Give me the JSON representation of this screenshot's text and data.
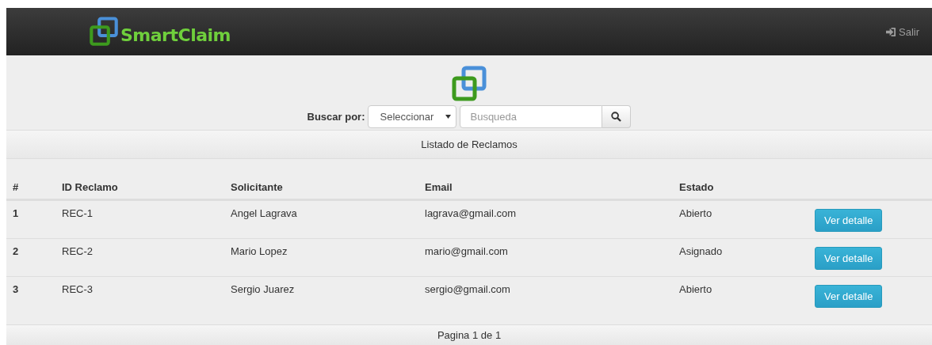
{
  "navbar": {
    "brand": "SmartClaim",
    "logout": "Salir"
  },
  "search": {
    "label": "Buscar por:",
    "select_value": "Seleccionar",
    "placeholder": "Busqueda"
  },
  "panel": {
    "title": "Listado de Reclamos"
  },
  "table": {
    "columns": [
      "#",
      "ID Reclamo",
      "Solicitante",
      "Email",
      "Estado"
    ],
    "rows": [
      {
        "number": "1",
        "id": "REC-1",
        "requester": "Angel Lagrava",
        "email": "lagrava@gmail.com",
        "status": "Abierto",
        "action": "Ver detalle"
      },
      {
        "number": "2",
        "id": "REC-2",
        "requester": "Mario Lopez",
        "email": "mario@gmail.com",
        "status": "Asignado",
        "action": "Ver detalle"
      },
      {
        "number": "3",
        "id": "REC-3",
        "requester": "Sergio Juarez",
        "email": "sergio@gmail.com",
        "status": "Abierto",
        "action": "Ver detalle"
      }
    ]
  },
  "footer": {
    "pagination": "Pagina 1 de 1"
  }
}
